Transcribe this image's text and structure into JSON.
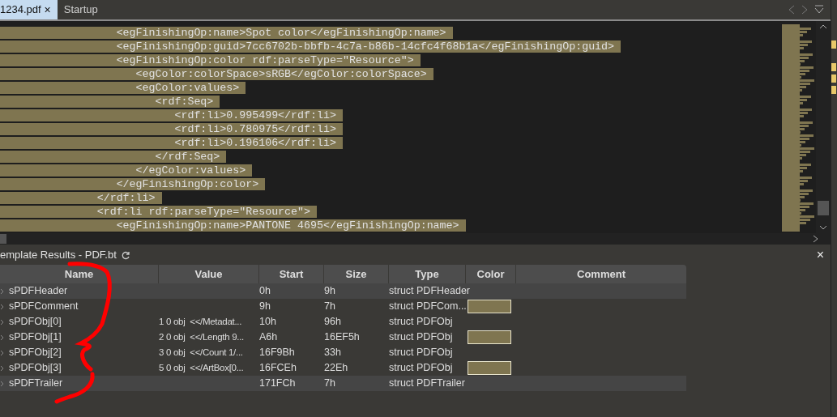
{
  "tabs": [
    {
      "label": "1234.pdf",
      "close": "×",
      "selected": true
    },
    {
      "label": "Startup",
      "selected": false
    }
  ],
  "editor": {
    "lines": [
      "                  <egFinishingOp:name>Spot color</egFinishingOp:name>",
      "                  <egFinishingOp:guid>7cc6702b-bbfb-4c7a-b86b-14cfc4f68b1a</egFinishingOp:guid>",
      "                  <egFinishingOp:color rdf:parseType=\"Resource\">",
      "                     <egColor:colorSpace>sRGB</egColor:colorSpace>",
      "                     <egColor:values>",
      "                        <rdf:Seq>",
      "                           <rdf:li>0.995499</rdf:li>",
      "                           <rdf:li>0.780975</rdf:li>",
      "                           <rdf:li>0.196106</rdf:li>",
      "                        </rdf:Seq>",
      "                     </egColor:values>",
      "                  </egFinishingOp:color>",
      "               </rdf:li>",
      "               <rdf:li rdf:parseType=\"Resource\">",
      "                  <egFinishingOp:name>PANTONE 4695</egFinishingOp:name>"
    ],
    "selected": true
  },
  "results": {
    "title": "emplate Results - PDF.bt",
    "close": "×",
    "columns": [
      "Name",
      "Value",
      "Start",
      "Size",
      "Type",
      "Color",
      "Comment"
    ],
    "rows": [
      {
        "name": "sPDFHeader",
        "value": "",
        "start": "0h",
        "size": "9h",
        "type": "struct PDFHeader",
        "shaded": true
      },
      {
        "name": "sPDFComment",
        "value": "",
        "start": "9h",
        "size": "7h",
        "type": "struct PDFCom...",
        "shaded": false,
        "color": "#7f7550"
      },
      {
        "name": "sPDFObj[0]",
        "value": "1 0 obj  <</Metadat...",
        "start": "10h",
        "size": "96h",
        "type": "struct PDFObj",
        "shaded": false
      },
      {
        "name": "sPDFObj[1]",
        "value": "2 0 obj  <</Length 9...",
        "start": "A6h",
        "size": "16EF5h",
        "type": "struct PDFObj",
        "shaded": false,
        "color": "#7f7550"
      },
      {
        "name": "sPDFObj[2]",
        "value": "3 0 obj  <</Count 1/...",
        "start": "16F9Bh",
        "size": "33h",
        "type": "struct PDFObj",
        "shaded": false
      },
      {
        "name": "sPDFObj[3]",
        "value": "5 0 obj  <</ArtBox[0...",
        "start": "16FCEh",
        "size": "22Eh",
        "type": "struct PDFObj",
        "shaded": false,
        "color": "#7f7550"
      },
      {
        "name": "sPDFTrailer",
        "value": "",
        "start": "171FCh",
        "size": "7h",
        "type": "struct PDFTrailer",
        "shaded": true
      }
    ]
  }
}
